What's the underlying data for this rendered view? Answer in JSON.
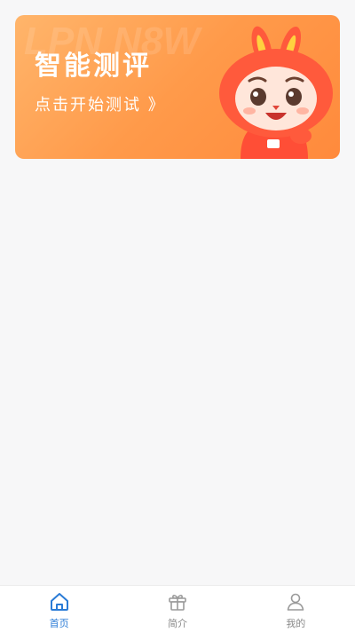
{
  "banner": {
    "title": "智能测评",
    "subtitle": "点击开始测试 》",
    "mascot_icon": "rabbit-mascot"
  },
  "tabbar": {
    "active_color": "#2a7bd6",
    "inactive_color": "#8a8a8a",
    "items": [
      {
        "label": "首页",
        "icon": "home-icon",
        "active": true
      },
      {
        "label": "简介",
        "icon": "gift-icon",
        "active": false
      },
      {
        "label": "我的",
        "icon": "user-icon",
        "active": false
      }
    ]
  }
}
